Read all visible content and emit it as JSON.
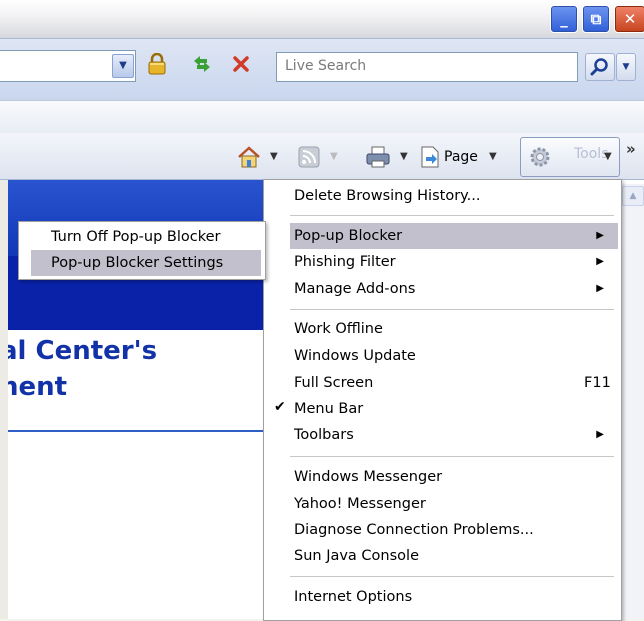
{
  "window": {
    "minimize": "_",
    "maximize": "⧉",
    "close": "✕"
  },
  "addressbar": {
    "search_placeholder": "Live Search"
  },
  "commandbar": {
    "page_label": "Page",
    "tools_label": "Tools",
    "overflow": "»"
  },
  "page": {
    "heading_line1": "al Center's",
    "heading_line2": "nent"
  },
  "tools_menu": {
    "items": [
      {
        "label": "Delete Browsing History...",
        "top": 0
      },
      {
        "label": "Pop-up Blocker",
        "submenu": true
      },
      {
        "label": "Phishing Filter",
        "submenu": true
      },
      {
        "label": "Manage Add-ons",
        "submenu": true
      },
      {
        "label": "Work Offline"
      },
      {
        "label": "Windows Update"
      },
      {
        "label": "Full Screen",
        "shortcut": "F11"
      },
      {
        "label": "Menu Bar",
        "checked": true
      },
      {
        "label": "Toolbars",
        "submenu": true
      },
      {
        "label": "Windows Messenger"
      },
      {
        "label": "Yahoo! Messenger"
      },
      {
        "label": "Diagnose Connection Problems..."
      },
      {
        "label": "Sun Java Console"
      },
      {
        "label": "Internet Options"
      }
    ]
  },
  "popup_submenu": {
    "items": [
      {
        "label": "Turn Off Pop-up Blocker"
      },
      {
        "label": "Pop-up Blocker Settings"
      }
    ]
  },
  "colors": {
    "menu_highlight": "#c3c0ce",
    "banner": "#0a22a8",
    "heading": "#1232a8"
  },
  "icons": [
    "lock-icon",
    "refresh-icon",
    "stop-icon",
    "search-icon",
    "home-icon",
    "feeds-icon",
    "print-icon",
    "page-icon",
    "gear-icon"
  ]
}
